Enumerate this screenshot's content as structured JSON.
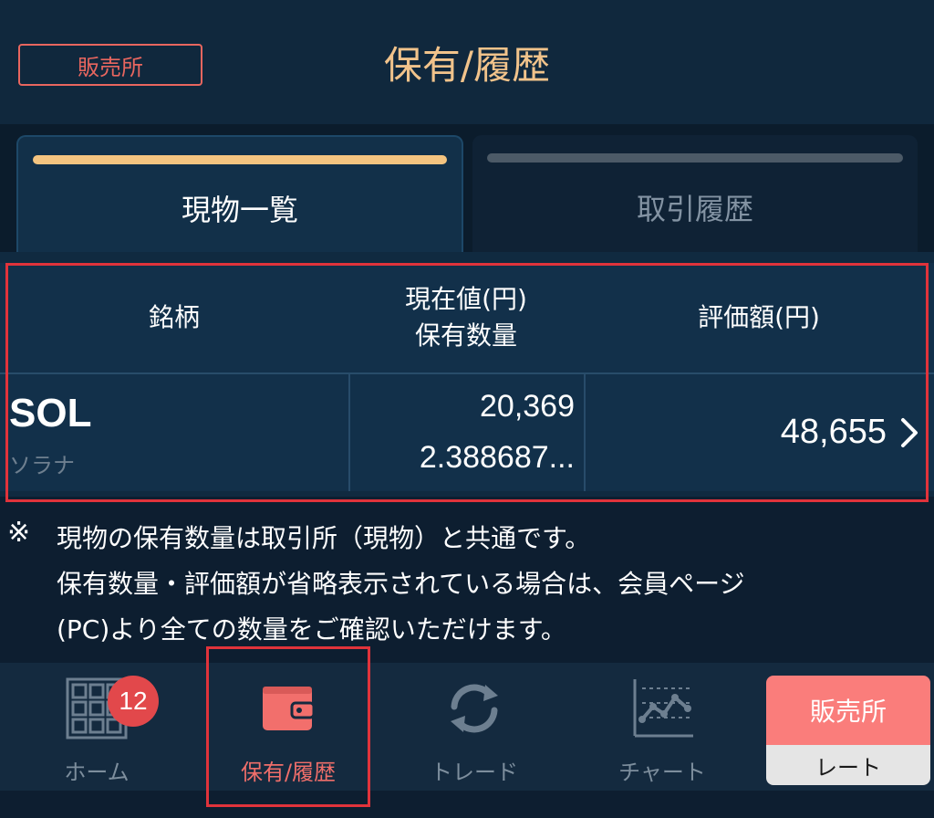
{
  "header": {
    "mode_badge": "販売所",
    "title": "保有/履歴"
  },
  "tabs": [
    {
      "label": "現物一覧",
      "active": true
    },
    {
      "label": "取引履歴",
      "active": false
    }
  ],
  "table": {
    "headers": {
      "symbol": "銘柄",
      "price_line1": "現在値(円)",
      "price_line2": "保有数量",
      "valuation": "評価額(円)"
    },
    "rows": [
      {
        "symbol": "SOL",
        "name": "ソラナ",
        "price": "20,369",
        "quantity": "2.388687...",
        "valuation": "48,655"
      }
    ]
  },
  "notes": {
    "mark": "※",
    "line1": "現物の保有数量は取引所（現物）と共通です。",
    "line2": "保有数量・評価額が省略表示されている場合は、会員ページ",
    "line3": "(PC)より全ての数量をご確認いただけます。"
  },
  "nav": {
    "items": [
      {
        "label": "ホーム",
        "icon": "grid-icon",
        "badge": "12"
      },
      {
        "label": "保有/履歴",
        "icon": "wallet-icon",
        "active": true
      },
      {
        "label": "トレード",
        "icon": "exchange-arrows-icon"
      },
      {
        "label": "チャート",
        "icon": "line-chart-icon"
      }
    ],
    "rate_button": {
      "top": "販売所",
      "bottom": "レート"
    }
  },
  "colors": {
    "accent_orange": "#f1c38b",
    "accent_red": "#ef6e6a",
    "highlight_red": "#e0333b",
    "background": "#0d1e30"
  }
}
